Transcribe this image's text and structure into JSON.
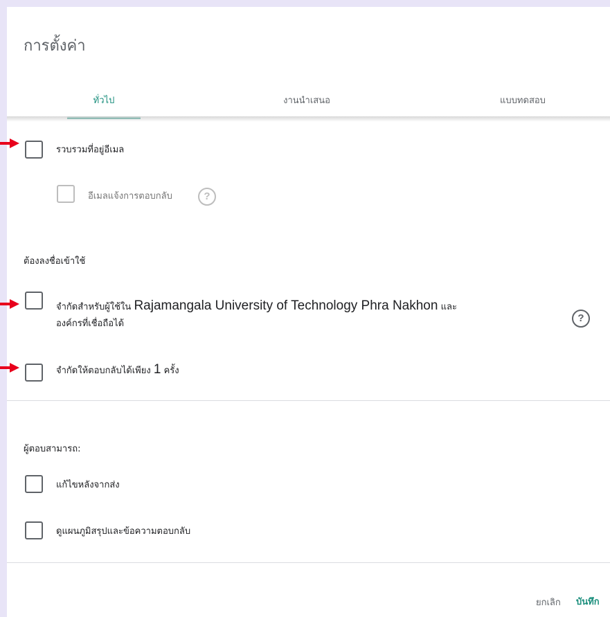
{
  "dialog": {
    "title": "การตั้งค่า"
  },
  "tabs": [
    {
      "label": "ทั่วไป",
      "active": true
    },
    {
      "label": "งานนำเสนอ",
      "active": false
    },
    {
      "label": "แบบทดสอบ",
      "active": false
    }
  ],
  "general": {
    "collect_email": {
      "label": "รวบรวมที่อยู่อีเมล",
      "checked": false
    },
    "response_receipts": {
      "label": "อีเมลแจ้งการตอบกลับ",
      "checked": false,
      "disabled": true
    },
    "requires_signin_heading": "ต้องลงชื่อเข้าใช้",
    "restrict_users": {
      "label_prefix": "จำกัดสำหรับผู้ใช้ใน",
      "organization": "Rajamangala University of Technology Phra Nakhon",
      "label_suffix": "และ",
      "label_line2": "องค์กรที่เชื่อถือได้",
      "checked": false
    },
    "limit_one": {
      "label_prefix": "จำกัดให้ตอบกลับได้เพียง",
      "count": "1",
      "label_suffix": "ครั้ง",
      "checked": false
    },
    "respondents_heading": "ผู้ตอบสามารถ:",
    "edit_after_submit": {
      "label": "แก้ไขหลังจากส่ง",
      "checked": false
    },
    "see_summary": {
      "label": "ดูแผนภูมิสรุปและข้อความตอบกลับ",
      "checked": false
    }
  },
  "actions": {
    "cancel_label": "ยกเลิก",
    "save_label": "บันทึก"
  },
  "colors": {
    "accent": "#1a8e7c",
    "background": "#e8e4f7",
    "annotation_arrow": "#e8001c"
  },
  "icons": {
    "help": "help-circle-icon",
    "annotation": "red-arrow-icon"
  }
}
